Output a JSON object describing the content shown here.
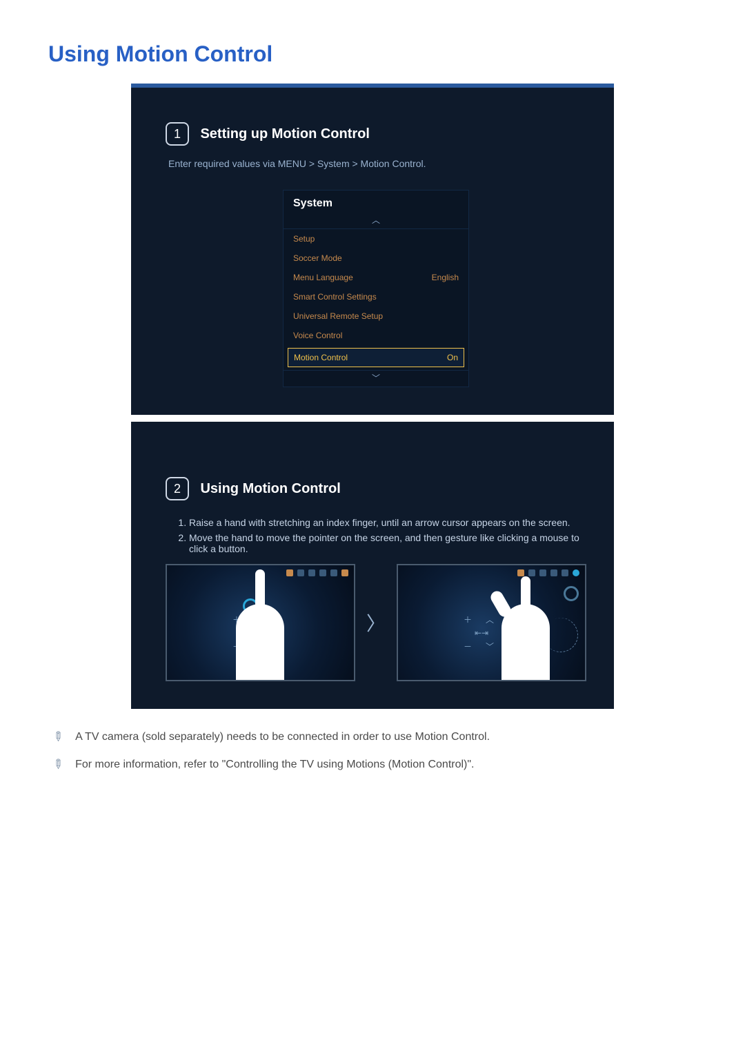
{
  "page_title": "Using Motion Control",
  "panel1": {
    "num": "1",
    "title": "Setting up Motion Control",
    "instruction": "Enter required values via MENU > System > Motion Control.",
    "menu": {
      "header": "System",
      "items": [
        {
          "label": "Setup",
          "value": ""
        },
        {
          "label": "Soccer Mode",
          "value": ""
        },
        {
          "label": "Menu Language",
          "value": "English"
        },
        {
          "label": "Smart Control Settings",
          "value": ""
        },
        {
          "label": "Universal Remote Setup",
          "value": ""
        },
        {
          "label": "Voice Control",
          "value": ""
        }
      ],
      "highlight": {
        "label": "Motion Control",
        "value": "On"
      }
    }
  },
  "panel2": {
    "num": "2",
    "title": "Using Motion Control",
    "steps": [
      "Raise a hand with stretching an index finger, until an arrow cursor appears on the screen.",
      "Move the hand to move the pointer on the screen, and then gesture like clicking a mouse to click a button."
    ]
  },
  "notes": [
    "A TV camera (sold separately) needs to be connected in order to use Motion Control.",
    "For more information, refer to \"Controlling the TV using Motions (Motion Control)\"."
  ]
}
